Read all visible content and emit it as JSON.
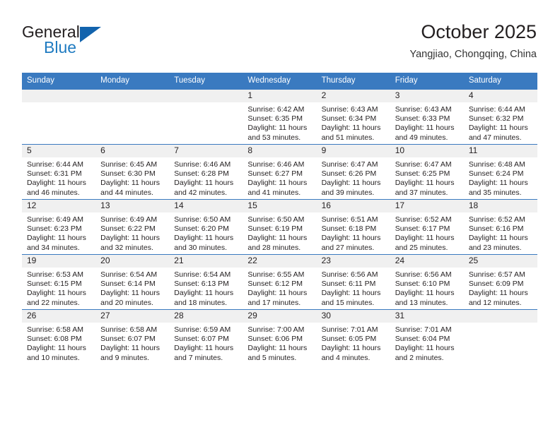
{
  "brand": {
    "name_top": "General",
    "name_bottom": "Blue",
    "triangle_color": "#1263ad",
    "blue_color": "#1f7bc1"
  },
  "header": {
    "title": "October 2025",
    "subtitle": "Yangjiao, Chongqing, China"
  },
  "theme": {
    "header_blue": "#3a7ac0",
    "daynum_bg": "#f0f0f0",
    "text": "#231f20"
  },
  "calendar": {
    "weekday_headers": [
      "Sunday",
      "Monday",
      "Tuesday",
      "Wednesday",
      "Thursday",
      "Friday",
      "Saturday"
    ],
    "labels": {
      "sunrise_prefix": "Sunrise:",
      "sunset_prefix": "Sunset:",
      "daylight_prefix": "Daylight:"
    },
    "weeks": [
      [
        {
          "day": "",
          "sunrise": "",
          "sunset": "",
          "daylight_line1": "",
          "daylight_line2": ""
        },
        {
          "day": "",
          "sunrise": "",
          "sunset": "",
          "daylight_line1": "",
          "daylight_line2": ""
        },
        {
          "day": "",
          "sunrise": "",
          "sunset": "",
          "daylight_line1": "",
          "daylight_line2": ""
        },
        {
          "day": "1",
          "sunrise": "Sunrise: 6:42 AM",
          "sunset": "Sunset: 6:35 PM",
          "daylight_line1": "Daylight: 11 hours",
          "daylight_line2": "and 53 minutes."
        },
        {
          "day": "2",
          "sunrise": "Sunrise: 6:43 AM",
          "sunset": "Sunset: 6:34 PM",
          "daylight_line1": "Daylight: 11 hours",
          "daylight_line2": "and 51 minutes."
        },
        {
          "day": "3",
          "sunrise": "Sunrise: 6:43 AM",
          "sunset": "Sunset: 6:33 PM",
          "daylight_line1": "Daylight: 11 hours",
          "daylight_line2": "and 49 minutes."
        },
        {
          "day": "4",
          "sunrise": "Sunrise: 6:44 AM",
          "sunset": "Sunset: 6:32 PM",
          "daylight_line1": "Daylight: 11 hours",
          "daylight_line2": "and 47 minutes."
        }
      ],
      [
        {
          "day": "5",
          "sunrise": "Sunrise: 6:44 AM",
          "sunset": "Sunset: 6:31 PM",
          "daylight_line1": "Daylight: 11 hours",
          "daylight_line2": "and 46 minutes."
        },
        {
          "day": "6",
          "sunrise": "Sunrise: 6:45 AM",
          "sunset": "Sunset: 6:30 PM",
          "daylight_line1": "Daylight: 11 hours",
          "daylight_line2": "and 44 minutes."
        },
        {
          "day": "7",
          "sunrise": "Sunrise: 6:46 AM",
          "sunset": "Sunset: 6:28 PM",
          "daylight_line1": "Daylight: 11 hours",
          "daylight_line2": "and 42 minutes."
        },
        {
          "day": "8",
          "sunrise": "Sunrise: 6:46 AM",
          "sunset": "Sunset: 6:27 PM",
          "daylight_line1": "Daylight: 11 hours",
          "daylight_line2": "and 41 minutes."
        },
        {
          "day": "9",
          "sunrise": "Sunrise: 6:47 AM",
          "sunset": "Sunset: 6:26 PM",
          "daylight_line1": "Daylight: 11 hours",
          "daylight_line2": "and 39 minutes."
        },
        {
          "day": "10",
          "sunrise": "Sunrise: 6:47 AM",
          "sunset": "Sunset: 6:25 PM",
          "daylight_line1": "Daylight: 11 hours",
          "daylight_line2": "and 37 minutes."
        },
        {
          "day": "11",
          "sunrise": "Sunrise: 6:48 AM",
          "sunset": "Sunset: 6:24 PM",
          "daylight_line1": "Daylight: 11 hours",
          "daylight_line2": "and 35 minutes."
        }
      ],
      [
        {
          "day": "12",
          "sunrise": "Sunrise: 6:49 AM",
          "sunset": "Sunset: 6:23 PM",
          "daylight_line1": "Daylight: 11 hours",
          "daylight_line2": "and 34 minutes."
        },
        {
          "day": "13",
          "sunrise": "Sunrise: 6:49 AM",
          "sunset": "Sunset: 6:22 PM",
          "daylight_line1": "Daylight: 11 hours",
          "daylight_line2": "and 32 minutes."
        },
        {
          "day": "14",
          "sunrise": "Sunrise: 6:50 AM",
          "sunset": "Sunset: 6:20 PM",
          "daylight_line1": "Daylight: 11 hours",
          "daylight_line2": "and 30 minutes."
        },
        {
          "day": "15",
          "sunrise": "Sunrise: 6:50 AM",
          "sunset": "Sunset: 6:19 PM",
          "daylight_line1": "Daylight: 11 hours",
          "daylight_line2": "and 28 minutes."
        },
        {
          "day": "16",
          "sunrise": "Sunrise: 6:51 AM",
          "sunset": "Sunset: 6:18 PM",
          "daylight_line1": "Daylight: 11 hours",
          "daylight_line2": "and 27 minutes."
        },
        {
          "day": "17",
          "sunrise": "Sunrise: 6:52 AM",
          "sunset": "Sunset: 6:17 PM",
          "daylight_line1": "Daylight: 11 hours",
          "daylight_line2": "and 25 minutes."
        },
        {
          "day": "18",
          "sunrise": "Sunrise: 6:52 AM",
          "sunset": "Sunset: 6:16 PM",
          "daylight_line1": "Daylight: 11 hours",
          "daylight_line2": "and 23 minutes."
        }
      ],
      [
        {
          "day": "19",
          "sunrise": "Sunrise: 6:53 AM",
          "sunset": "Sunset: 6:15 PM",
          "daylight_line1": "Daylight: 11 hours",
          "daylight_line2": "and 22 minutes."
        },
        {
          "day": "20",
          "sunrise": "Sunrise: 6:54 AM",
          "sunset": "Sunset: 6:14 PM",
          "daylight_line1": "Daylight: 11 hours",
          "daylight_line2": "and 20 minutes."
        },
        {
          "day": "21",
          "sunrise": "Sunrise: 6:54 AM",
          "sunset": "Sunset: 6:13 PM",
          "daylight_line1": "Daylight: 11 hours",
          "daylight_line2": "and 18 minutes."
        },
        {
          "day": "22",
          "sunrise": "Sunrise: 6:55 AM",
          "sunset": "Sunset: 6:12 PM",
          "daylight_line1": "Daylight: 11 hours",
          "daylight_line2": "and 17 minutes."
        },
        {
          "day": "23",
          "sunrise": "Sunrise: 6:56 AM",
          "sunset": "Sunset: 6:11 PM",
          "daylight_line1": "Daylight: 11 hours",
          "daylight_line2": "and 15 minutes."
        },
        {
          "day": "24",
          "sunrise": "Sunrise: 6:56 AM",
          "sunset": "Sunset: 6:10 PM",
          "daylight_line1": "Daylight: 11 hours",
          "daylight_line2": "and 13 minutes."
        },
        {
          "day": "25",
          "sunrise": "Sunrise: 6:57 AM",
          "sunset": "Sunset: 6:09 PM",
          "daylight_line1": "Daylight: 11 hours",
          "daylight_line2": "and 12 minutes."
        }
      ],
      [
        {
          "day": "26",
          "sunrise": "Sunrise: 6:58 AM",
          "sunset": "Sunset: 6:08 PM",
          "daylight_line1": "Daylight: 11 hours",
          "daylight_line2": "and 10 minutes."
        },
        {
          "day": "27",
          "sunrise": "Sunrise: 6:58 AM",
          "sunset": "Sunset: 6:07 PM",
          "daylight_line1": "Daylight: 11 hours",
          "daylight_line2": "and 9 minutes."
        },
        {
          "day": "28",
          "sunrise": "Sunrise: 6:59 AM",
          "sunset": "Sunset: 6:07 PM",
          "daylight_line1": "Daylight: 11 hours",
          "daylight_line2": "and 7 minutes."
        },
        {
          "day": "29",
          "sunrise": "Sunrise: 7:00 AM",
          "sunset": "Sunset: 6:06 PM",
          "daylight_line1": "Daylight: 11 hours",
          "daylight_line2": "and 5 minutes."
        },
        {
          "day": "30",
          "sunrise": "Sunrise: 7:01 AM",
          "sunset": "Sunset: 6:05 PM",
          "daylight_line1": "Daylight: 11 hours",
          "daylight_line2": "and 4 minutes."
        },
        {
          "day": "31",
          "sunrise": "Sunrise: 7:01 AM",
          "sunset": "Sunset: 6:04 PM",
          "daylight_line1": "Daylight: 11 hours",
          "daylight_line2": "and 2 minutes."
        },
        {
          "day": "",
          "sunrise": "",
          "sunset": "",
          "daylight_line1": "",
          "daylight_line2": ""
        }
      ]
    ]
  }
}
